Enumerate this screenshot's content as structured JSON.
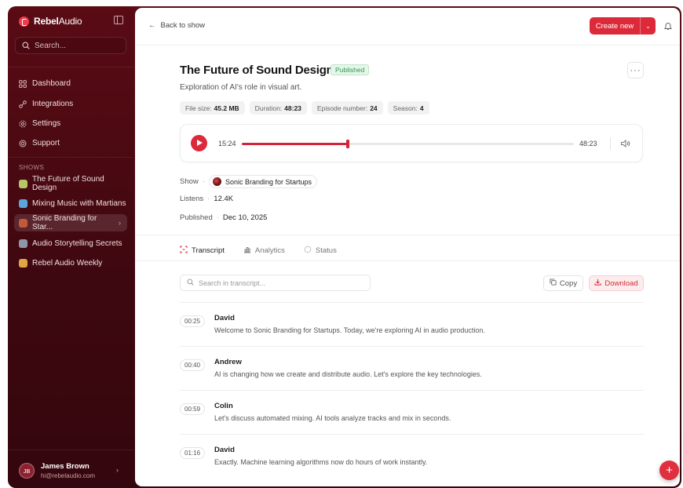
{
  "brand": {
    "name_bold": "Rebel",
    "name_light": "Audio"
  },
  "sidebar": {
    "search_placeholder": "Search...",
    "nav": [
      {
        "label": "Dashboard",
        "icon": "grid-icon"
      },
      {
        "label": "Integrations",
        "icon": "integrations-icon"
      },
      {
        "label": "Settings",
        "icon": "gear-icon"
      },
      {
        "label": "Support",
        "icon": "support-icon"
      }
    ],
    "shows_label": "SHOWS",
    "shows": [
      {
        "label": "The Future of Sound Design",
        "color": "#b7c56a"
      },
      {
        "label": "Mixing Music with Martians",
        "color": "#5da4d8"
      },
      {
        "label": "Sonic Branding for Star...",
        "color": "#c25a3a",
        "active": true
      },
      {
        "label": "Audio Storytelling Secrets",
        "color": "#8f96a8"
      },
      {
        "label": "Rebel Audio Weekly",
        "color": "#e2a446"
      }
    ],
    "user": {
      "initials": "JB",
      "name": "James Brown",
      "email": "hi@rebelaudio.com"
    }
  },
  "topbar": {
    "back_label": "Back to show",
    "create_label": "Create new"
  },
  "episode": {
    "title": "The Future of Sound Design",
    "status": "Published",
    "description": "Exploration of AI's role in visual art.",
    "meta": [
      {
        "label": "File size:",
        "value": "45.2 MB"
      },
      {
        "label": "Duration:",
        "value": "48:23"
      },
      {
        "label": "Episode number:",
        "value": "24"
      },
      {
        "label": "Season:",
        "value": "4"
      }
    ],
    "player": {
      "current": "15:24",
      "total": "48:23",
      "progress": 0.318
    },
    "show_label": "Show",
    "show_name": "Sonic Branding for Startups",
    "listens_label": "Listens",
    "listens": "12.4K",
    "published_label": "Published",
    "published": "Dec 10, 2025"
  },
  "tabs": [
    {
      "label": "Transcript",
      "active": true
    },
    {
      "label": "Analytics"
    },
    {
      "label": "Status"
    }
  ],
  "transcript": {
    "search_placeholder": "Search in transcript...",
    "copy_label": "Copy",
    "download_label": "Download",
    "lines": [
      {
        "time": "00:25",
        "speaker": "David",
        "text": "Welcome to Sonic Branding for Startups. Today, we're exploring AI in audio production."
      },
      {
        "time": "00:40",
        "speaker": "Andrew",
        "text": "AI is changing how we create and distribute audio. Let's explore the key technologies."
      },
      {
        "time": "00:59",
        "speaker": "Colin",
        "text": "Let's discuss automated mixing. AI tools analyze tracks and mix in seconds."
      },
      {
        "time": "01:16",
        "speaker": "David",
        "text": "Exactly. Machine learning algorithms now do hours of work instantly."
      }
    ]
  },
  "colors": {
    "accent": "#dc2a3a",
    "sidebar_bg": "#4a0a12",
    "published_green": "#2a9a4f"
  }
}
